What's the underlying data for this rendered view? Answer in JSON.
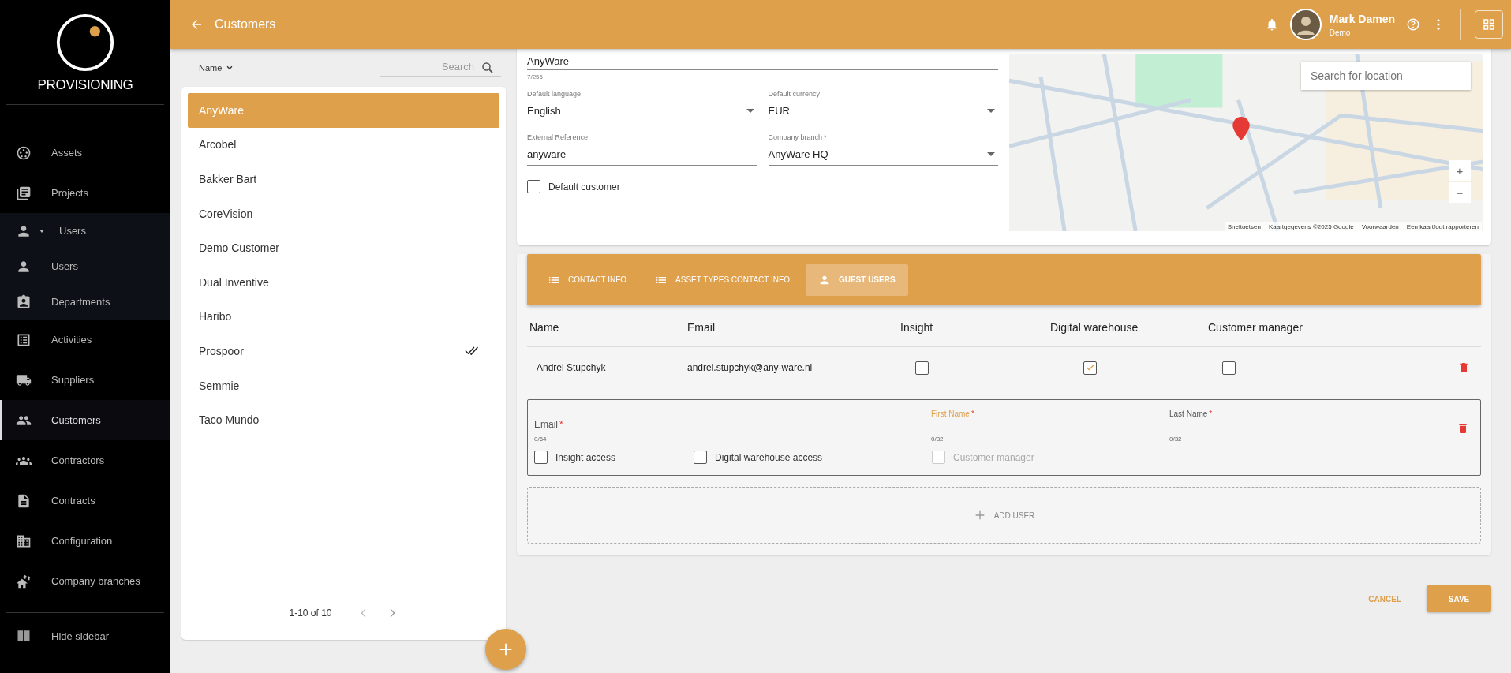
{
  "sidebar": {
    "logo_text": "PROVISIONING",
    "items": [
      {
        "label": "Assets",
        "selected": false
      },
      {
        "label": "Projects",
        "selected": false
      },
      {
        "label": "Users",
        "selected": false,
        "expanded": true,
        "children": [
          {
            "label": "Users",
            "selected": false
          },
          {
            "label": "Departments",
            "selected": false
          }
        ]
      },
      {
        "label": "Activities",
        "selected": false
      },
      {
        "label": "Suppliers",
        "selected": false
      },
      {
        "label": "Customers",
        "selected": true
      },
      {
        "label": "Contractors",
        "selected": false
      },
      {
        "label": "Contracts",
        "selected": false
      },
      {
        "label": "Configuration",
        "selected": false
      },
      {
        "label": "Company branches",
        "selected": false
      }
    ],
    "footer": "Hide sidebar"
  },
  "topbar": {
    "title": "Customers",
    "user_name": "Mark Damen",
    "user_role": "Demo"
  },
  "customer_list": {
    "sort_label": "Name",
    "search": {
      "placeholder": "Search"
    },
    "items": [
      {
        "name": "AnyWare",
        "selected": true,
        "marked": false
      },
      {
        "name": "Arcobel",
        "selected": false,
        "marked": false
      },
      {
        "name": "Bakker Bart",
        "selected": false,
        "marked": false
      },
      {
        "name": "CoreVision",
        "selected": false,
        "marked": false
      },
      {
        "name": "Demo Customer",
        "selected": false,
        "marked": false
      },
      {
        "name": "Dual Inventive",
        "selected": false,
        "marked": false
      },
      {
        "name": "Haribo",
        "selected": false,
        "marked": false
      },
      {
        "name": "Prospoor",
        "selected": false,
        "marked": true
      },
      {
        "name": "Semmie",
        "selected": false,
        "marked": false
      },
      {
        "name": "Taco Mundo",
        "selected": false,
        "marked": false
      }
    ],
    "pagination": "1-10 of 10"
  },
  "form": {
    "name": {
      "value": "AnyWare",
      "counter": "7/255"
    },
    "fields": [
      {
        "kind": "select",
        "label": "Default language",
        "value": "English"
      },
      {
        "kind": "select",
        "label": "Default currency",
        "value": "EUR"
      },
      {
        "kind": "text",
        "label": "External Reference",
        "value": "anyware"
      },
      {
        "kind": "select",
        "label": "Company branch",
        "value": "AnyWare HQ",
        "required_mark": "*"
      }
    ],
    "default_customer": {
      "label": "Default customer",
      "checked": false
    }
  },
  "map": {
    "search": {
      "placeholder": "Search for location"
    },
    "zoom_in": "+",
    "zoom_out": "−",
    "attribution": [
      "Sneltoetsen",
      "Kaartgegevens ©2025 Google",
      "Voorwaarden",
      "Een kaartfout rapporteren"
    ]
  },
  "tabs": [
    {
      "label": "CONTACT INFO",
      "selected": false
    },
    {
      "label": "ASSET TYPES CONTACT INFO",
      "selected": false
    },
    {
      "label": "GUEST USERS",
      "selected": true
    }
  ],
  "guest_table": {
    "columns": [
      "Name",
      "Email",
      "Insight",
      "Digital warehouse",
      "Customer manager"
    ],
    "rows": [
      {
        "name": "Andrei Stupchyk",
        "email": "andrei.stupchyk@any-ware.nl",
        "insight": false,
        "digital_warehouse": true,
        "customer_manager": false
      }
    ]
  },
  "new_user": {
    "fields": [
      {
        "label": "Email",
        "required_mark": "*",
        "counter": "0/64",
        "focused": false
      },
      {
        "label": "First Name",
        "required_mark": "*",
        "counter": "0/32",
        "focused": true
      },
      {
        "label": "Last Name",
        "required_mark": "*",
        "counter": "0/32",
        "focused": false
      }
    ],
    "checkboxes": [
      {
        "label": "Insight access",
        "checked": false,
        "disabled": false
      },
      {
        "label": "Digital warehouse access",
        "checked": false,
        "disabled": false
      },
      {
        "label": "Customer manager",
        "checked": false,
        "disabled": true
      }
    ]
  },
  "add_user": "ADD USER",
  "actions": {
    "cancel": "CANCEL",
    "save": "SAVE"
  }
}
